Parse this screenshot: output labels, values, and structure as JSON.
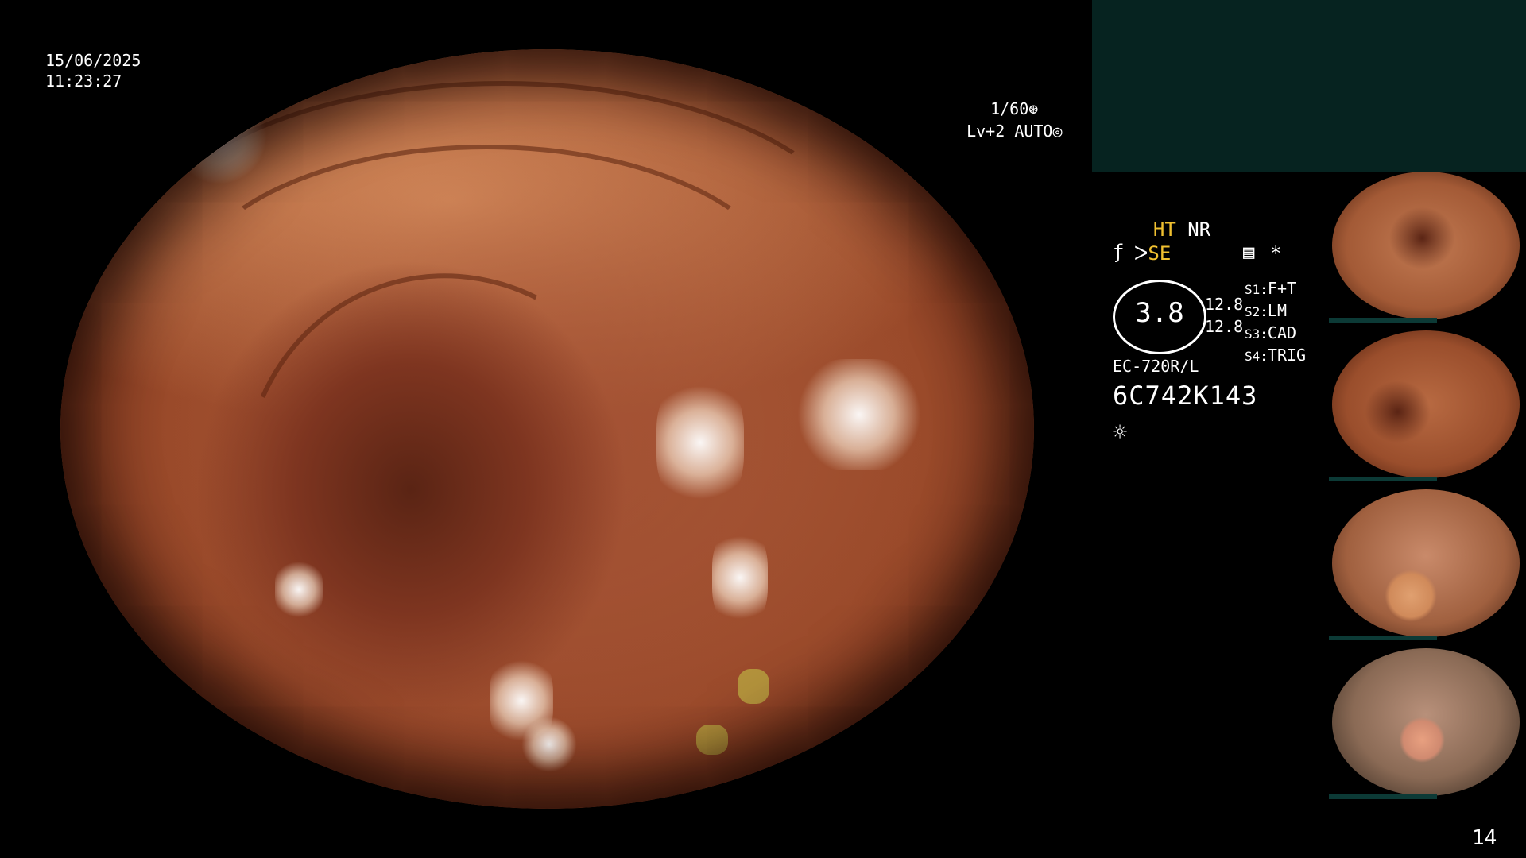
{
  "overlay": {
    "date": "15/06/2025",
    "time": "11:23:27",
    "shutter": "1/60",
    "shutter_icon": "aperture-icon",
    "level": "Lv+2",
    "mode": "AUTO",
    "mode_icon": "auto-iris-icon"
  },
  "status": {
    "ht": "HT",
    "nr": "NR",
    "se": "SE",
    "se_icon": "wire-icon",
    "f_icon": "f-icon",
    "memo_icon": "memo-icon",
    "asterisk": "*",
    "gauge_value": "3.8",
    "zoom1": "12.8",
    "zoom2": "12.8",
    "switches": [
      {
        "key": "S1:",
        "value": "F+T"
      },
      {
        "key": "S2:",
        "value": "LM"
      },
      {
        "key": "S3:",
        "value": "CAD"
      },
      {
        "key": "S4:",
        "value": "TRIG"
      }
    ],
    "scope_model": "EC-720R/L",
    "scope_serial": "6C742K143",
    "light_icon": "sun-icon"
  },
  "thumbnails": [
    {
      "label": "thumbnail-1"
    },
    {
      "label": "thumbnail-2"
    },
    {
      "label": "thumbnail-3"
    },
    {
      "label": "thumbnail-4"
    }
  ],
  "page_number": "14",
  "colors": {
    "accent_yellow": "#f0c030",
    "panel_teal": "#062320"
  }
}
